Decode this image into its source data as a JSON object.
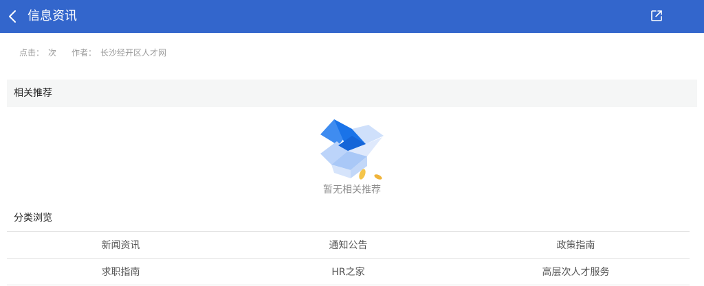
{
  "header": {
    "title": "信息资讯",
    "back_icon": "chevron-left-icon",
    "share_icon": "share-icon",
    "background_color": "#3366cc"
  },
  "meta": {
    "clicks_label": "点击：",
    "clicks_unit": "次",
    "author_label": "作者：",
    "author_value": "长沙经开区人才网"
  },
  "related": {
    "title": "相关推荐",
    "empty_text": "暂无相关推荐",
    "empty_icon": "empty-box-icon"
  },
  "categories": {
    "title": "分类浏览",
    "items": [
      "新闻资讯",
      "通知公告",
      "政策指南",
      "求职指南",
      "HR之家",
      "高层次人才服务"
    ]
  }
}
